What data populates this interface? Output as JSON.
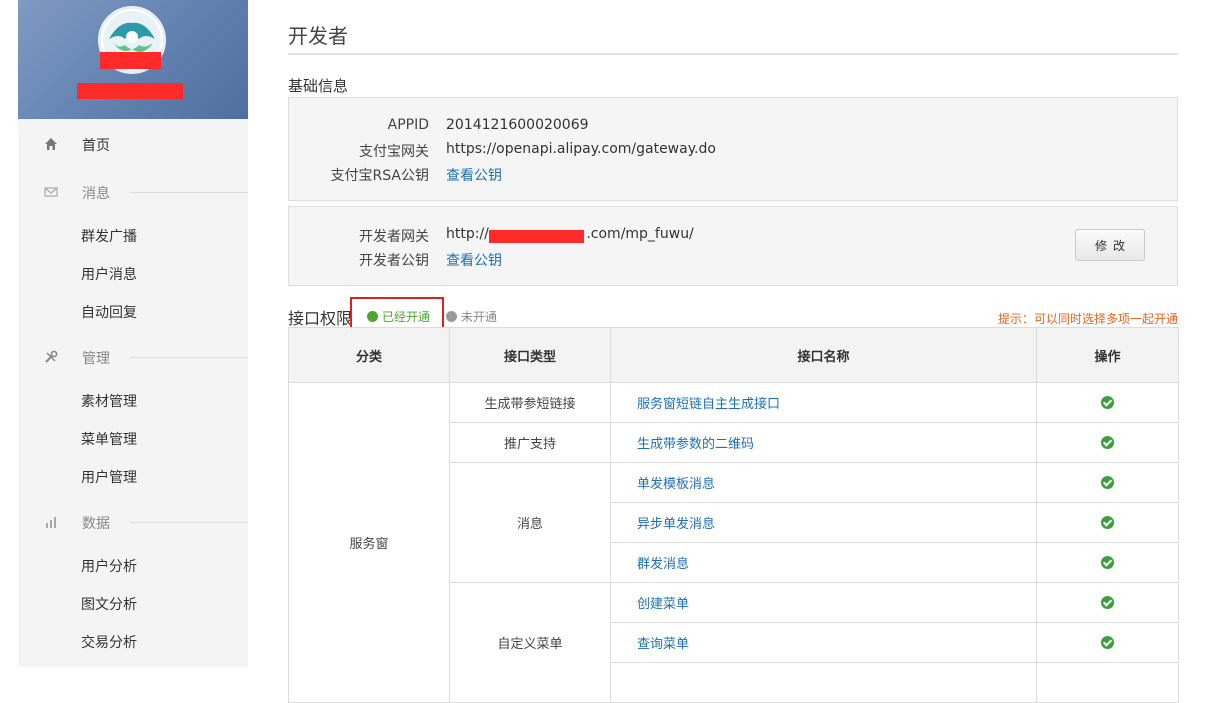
{
  "sidebar": {
    "home": "首页",
    "sections": [
      {
        "label": "消息",
        "items": [
          "群发广播",
          "用户消息",
          "自动回复"
        ]
      },
      {
        "label": "管理",
        "items": [
          "素材管理",
          "菜单管理",
          "用户管理"
        ]
      },
      {
        "label": "数据",
        "items": [
          "用户分析",
          "图文分析",
          "交易分析"
        ]
      }
    ]
  },
  "page": {
    "title": "开发者",
    "basic_title": "基础信息",
    "basic": {
      "appid_label": "APPID",
      "appid_value": "2014121600020069",
      "gateway_label": "支付宝网关",
      "gateway_value": "https://openapi.alipay.com/gateway.do",
      "rsa_label": "支付宝RSA公钥",
      "rsa_link": "查看公钥"
    },
    "dev": {
      "gateway_label": "开发者网关",
      "gateway_value": "http://w",
      "gateway_value_tail": ".com/mp_fuwu/",
      "key_label": "开发者公钥",
      "key_link": "查看公钥",
      "edit_button": "修改"
    },
    "perm": {
      "title": "接口权限",
      "legend_on": "已经开通",
      "legend_off": "未开通",
      "tip": "提示：可以同时选择多项一起开通",
      "headers": [
        "分类",
        "接口类型",
        "接口名称",
        "操作"
      ],
      "category": "服务窗",
      "types": [
        "生成带参短链接",
        "推广支持",
        "消息",
        "自定义菜单"
      ],
      "names": [
        "服务窗短链自主生成接口",
        "生成带参数的二维码",
        "单发模板消息",
        "异步单发消息",
        "群发消息",
        "创建菜单",
        "查询菜单"
      ]
    }
  },
  "colors": {
    "link": "#1e6fb8",
    "enabled": "#3aa13a",
    "tip": "#e8641f",
    "highlight": "#e02020"
  }
}
